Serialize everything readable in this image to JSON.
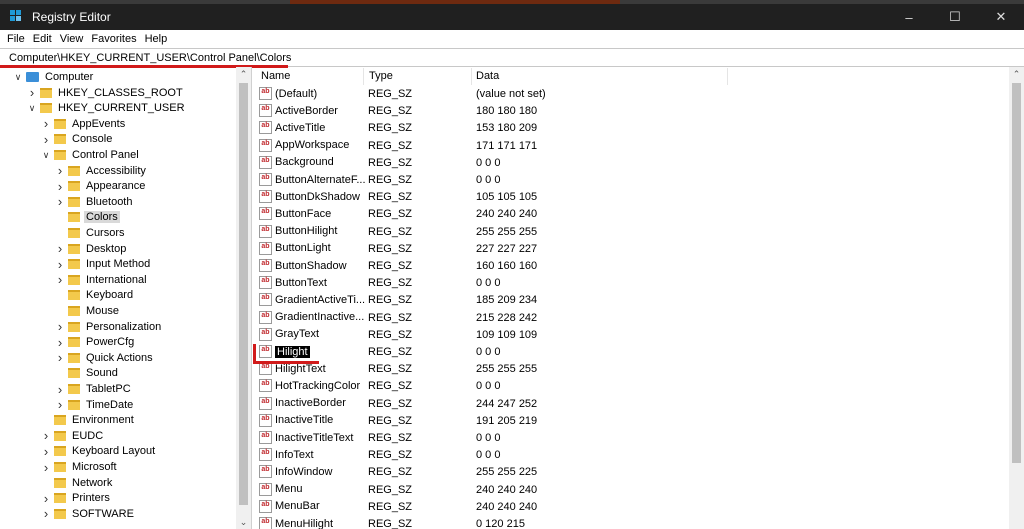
{
  "window": {
    "title": "Registry Editor"
  },
  "menu": [
    "File",
    "Edit",
    "View",
    "Favorites",
    "Help"
  ],
  "address": "Computer\\HKEY_CURRENT_USER\\Control Panel\\Colors",
  "tree": [
    {
      "label": "Computer",
      "depth": 0,
      "chevron": "down",
      "icon": "computer-icon"
    },
    {
      "label": "HKEY_CLASSES_ROOT",
      "depth": 1,
      "chevron": "right",
      "icon": "folder-icon"
    },
    {
      "label": "HKEY_CURRENT_USER",
      "depth": 1,
      "chevron": "down",
      "icon": "folder-icon"
    },
    {
      "label": "AppEvents",
      "depth": 2,
      "chevron": "right",
      "icon": "folder-icon"
    },
    {
      "label": "Console",
      "depth": 2,
      "chevron": "right",
      "icon": "folder-icon"
    },
    {
      "label": "Control Panel",
      "depth": 2,
      "chevron": "down",
      "icon": "folder-icon"
    },
    {
      "label": "Accessibility",
      "depth": 3,
      "chevron": "right",
      "icon": "folder-icon"
    },
    {
      "label": "Appearance",
      "depth": 3,
      "chevron": "right",
      "icon": "folder-icon"
    },
    {
      "label": "Bluetooth",
      "depth": 3,
      "chevron": "right",
      "icon": "folder-icon"
    },
    {
      "label": "Colors",
      "depth": 3,
      "chevron": "",
      "icon": "folder-icon",
      "selected": true
    },
    {
      "label": "Cursors",
      "depth": 3,
      "chevron": "",
      "icon": "folder-icon"
    },
    {
      "label": "Desktop",
      "depth": 3,
      "chevron": "right",
      "icon": "folder-icon"
    },
    {
      "label": "Input Method",
      "depth": 3,
      "chevron": "right",
      "icon": "folder-icon"
    },
    {
      "label": "International",
      "depth": 3,
      "chevron": "right",
      "icon": "folder-icon"
    },
    {
      "label": "Keyboard",
      "depth": 3,
      "chevron": "",
      "icon": "folder-icon"
    },
    {
      "label": "Mouse",
      "depth": 3,
      "chevron": "",
      "icon": "folder-icon"
    },
    {
      "label": "Personalization",
      "depth": 3,
      "chevron": "right",
      "icon": "folder-icon"
    },
    {
      "label": "PowerCfg",
      "depth": 3,
      "chevron": "right",
      "icon": "folder-icon"
    },
    {
      "label": "Quick Actions",
      "depth": 3,
      "chevron": "right",
      "icon": "folder-icon"
    },
    {
      "label": "Sound",
      "depth": 3,
      "chevron": "",
      "icon": "folder-icon"
    },
    {
      "label": "TabletPC",
      "depth": 3,
      "chevron": "right",
      "icon": "folder-icon"
    },
    {
      "label": "TimeDate",
      "depth": 3,
      "chevron": "right",
      "icon": "folder-icon"
    },
    {
      "label": "Environment",
      "depth": 2,
      "chevron": "",
      "icon": "folder-icon"
    },
    {
      "label": "EUDC",
      "depth": 2,
      "chevron": "right",
      "icon": "folder-icon"
    },
    {
      "label": "Keyboard Layout",
      "depth": 2,
      "chevron": "right",
      "icon": "folder-icon"
    },
    {
      "label": "Microsoft",
      "depth": 2,
      "chevron": "right",
      "icon": "folder-icon"
    },
    {
      "label": "Network",
      "depth": 2,
      "chevron": "",
      "icon": "folder-icon"
    },
    {
      "label": "Printers",
      "depth": 2,
      "chevron": "right",
      "icon": "folder-icon"
    },
    {
      "label": "SOFTWARE",
      "depth": 2,
      "chevron": "right",
      "icon": "folder-icon"
    }
  ],
  "columns": {
    "name": "Name",
    "type": "Type",
    "data": "Data"
  },
  "values": [
    {
      "name": "(Default)",
      "type": "REG_SZ",
      "data": "(value not set)"
    },
    {
      "name": "ActiveBorder",
      "type": "REG_SZ",
      "data": "180 180 180"
    },
    {
      "name": "ActiveTitle",
      "type": "REG_SZ",
      "data": "153 180 209"
    },
    {
      "name": "AppWorkspace",
      "type": "REG_SZ",
      "data": "171 171 171"
    },
    {
      "name": "Background",
      "type": "REG_SZ",
      "data": "0 0 0"
    },
    {
      "name": "ButtonAlternateF...",
      "type": "REG_SZ",
      "data": "0 0 0"
    },
    {
      "name": "ButtonDkShadow",
      "type": "REG_SZ",
      "data": "105 105 105"
    },
    {
      "name": "ButtonFace",
      "type": "REG_SZ",
      "data": "240 240 240"
    },
    {
      "name": "ButtonHilight",
      "type": "REG_SZ",
      "data": "255 255 255"
    },
    {
      "name": "ButtonLight",
      "type": "REG_SZ",
      "data": "227 227 227"
    },
    {
      "name": "ButtonShadow",
      "type": "REG_SZ",
      "data": "160 160 160"
    },
    {
      "name": "ButtonText",
      "type": "REG_SZ",
      "data": "0 0 0"
    },
    {
      "name": "GradientActiveTi...",
      "type": "REG_SZ",
      "data": "185 209 234"
    },
    {
      "name": "GradientInactive...",
      "type": "REG_SZ",
      "data": "215 228 242"
    },
    {
      "name": "GrayText",
      "type": "REG_SZ",
      "data": "109 109 109"
    },
    {
      "name": "Hilight",
      "type": "REG_SZ",
      "data": "0 0 0",
      "selected": true
    },
    {
      "name": "HilightText",
      "type": "REG_SZ",
      "data": "255 255 255"
    },
    {
      "name": "HotTrackingColor",
      "type": "REG_SZ",
      "data": "0 0 0"
    },
    {
      "name": "InactiveBorder",
      "type": "REG_SZ",
      "data": "244 247 252"
    },
    {
      "name": "InactiveTitle",
      "type": "REG_SZ",
      "data": "191 205 219"
    },
    {
      "name": "InactiveTitleText",
      "type": "REG_SZ",
      "data": "0 0 0"
    },
    {
      "name": "InfoText",
      "type": "REG_SZ",
      "data": "0 0 0"
    },
    {
      "name": "InfoWindow",
      "type": "REG_SZ",
      "data": "255 255 225"
    },
    {
      "name": "Menu",
      "type": "REG_SZ",
      "data": "240 240 240"
    },
    {
      "name": "MenuBar",
      "type": "REG_SZ",
      "data": "240 240 240"
    },
    {
      "name": "MenuHilight",
      "type": "REG_SZ",
      "data": "0 120 215"
    }
  ],
  "value_icon_text": "ab",
  "colors": {
    "title_bg": "#202020",
    "annotation_red": "#d11a1a",
    "tree_selected_bg": "#d9d9d9",
    "value_selected_bg": "#000000"
  }
}
